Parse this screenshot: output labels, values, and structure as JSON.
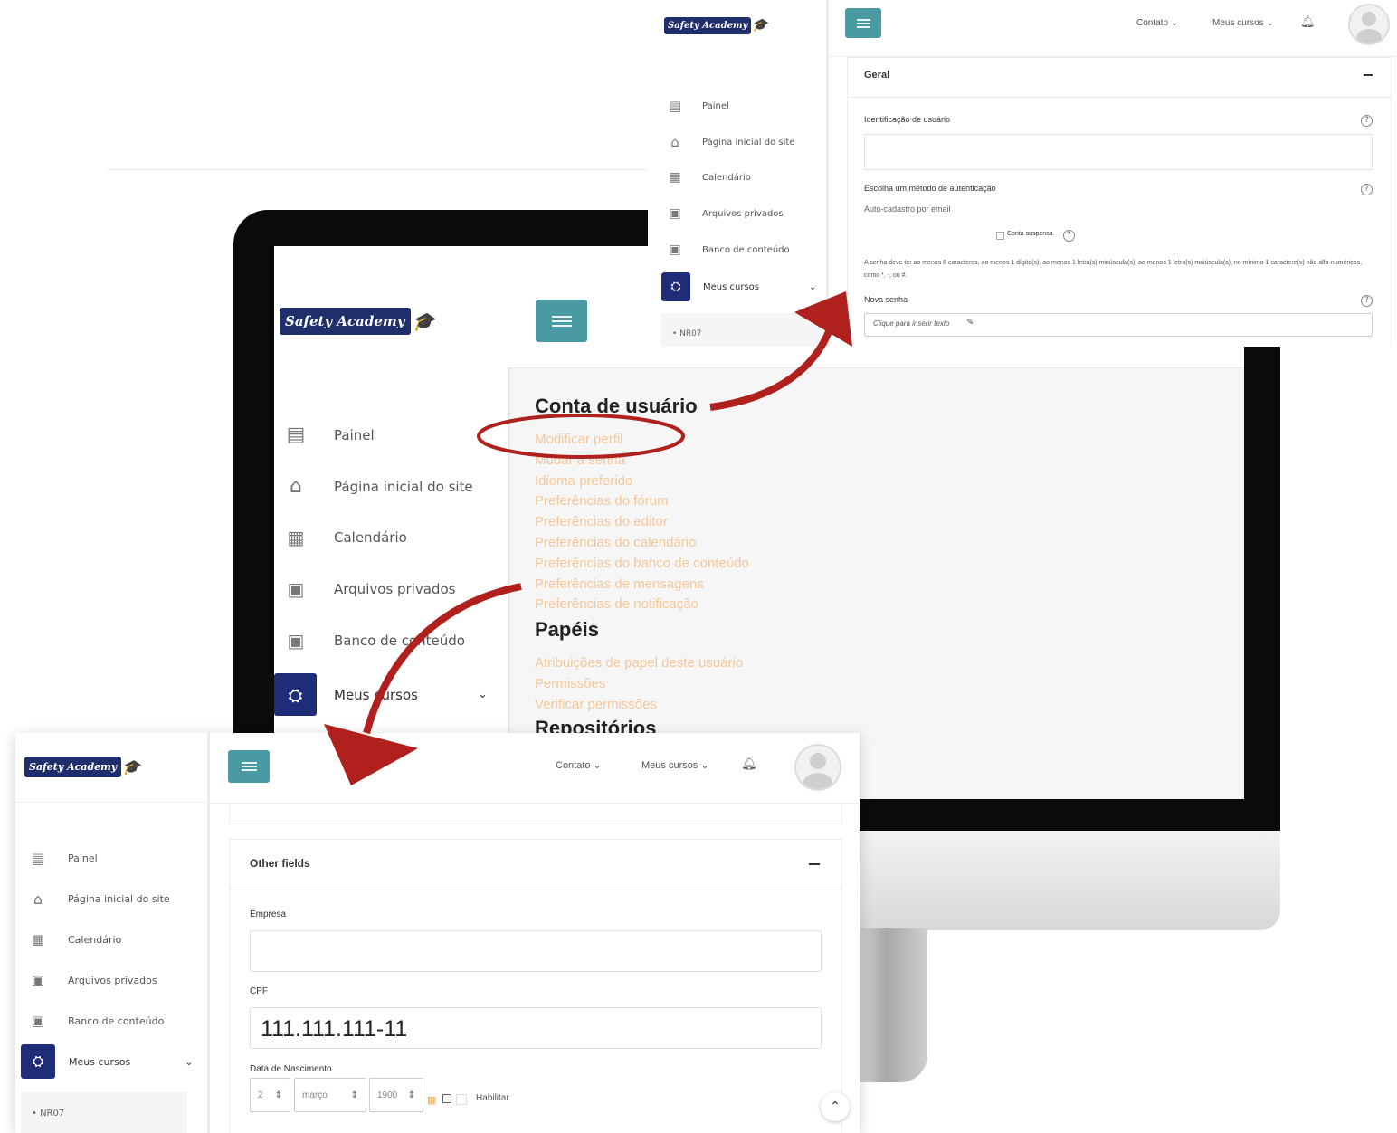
{
  "brand": {
    "logo_text": "Safety Academy"
  },
  "nav": {
    "contato": "Contato",
    "meus_cursos": "Meus cursos"
  },
  "sidebar": {
    "items": [
      "Painel",
      "Página inicial do site",
      "Calendário",
      "Arquivos privados",
      "Banco de conteúdo"
    ],
    "active": "Meus cursos",
    "sub_item": "NR07"
  },
  "account": {
    "heading": "Conta de usuário",
    "links": [
      "Modificar perfil",
      "Mudar a senha",
      "Idioma preferido",
      "Preferências do fórum",
      "Preferências do editor",
      "Preferências do calendário",
      "Preferências do banco de conteúdo",
      "Preferências de mensagens",
      "Preferências de notificação"
    ],
    "roles_heading": "Papéis",
    "roles_links": [
      "Atribuições de papel deste usuário",
      "Permissões",
      "Verificar permissões"
    ],
    "repos_heading": "Repositórios"
  },
  "form_general": {
    "section": "Geral",
    "user_id_label": "Identificação de usuário",
    "auth_label": "Escolha um método de autenticação",
    "auth_value": "Auto-cadastro por email",
    "suspended_label": "Conta suspensa",
    "password_note": "A senha deve ter ao menos 8 caracteres, ao menos 1 dígito(s), ao menos 1 letra(s) minúscula(s), ao menos 1 letra(s) maiúscula(s), no mínimo 1 caractere(s) não alfa-numéricos, como *, -, ou #.",
    "new_password_label": "Nova senha",
    "new_password_placeholder": "Clique para inserir texto"
  },
  "form_other": {
    "section": "Other fields",
    "empresa_label": "Empresa",
    "cpf_label": "CPF",
    "cpf_value": "111.111.111-11",
    "birth_label": "Data de Nascimento",
    "day": "2",
    "month": "março",
    "year": "1900",
    "enable_label": "Habilitar"
  },
  "colors": {
    "accent_teal": "#4a9aa3",
    "active_navy": "#1f2c78",
    "link_orange": "#f7c79a",
    "arrow_red": "#b0201d"
  }
}
